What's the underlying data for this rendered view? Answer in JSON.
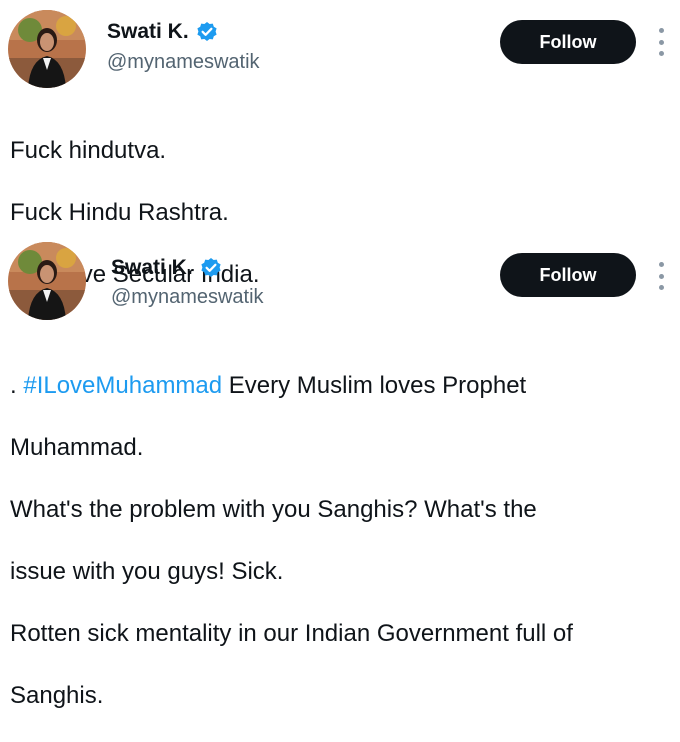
{
  "tweets": [
    {
      "author": {
        "display_name": "Swati K.",
        "handle": "@mynameswatik",
        "verified": true,
        "verified_icon": "verified-badge-icon"
      },
      "follow_label": "Follow",
      "more_icon": "more-options-icon",
      "text_lines": [
        "Fuck hindutva.",
        "Fuck Hindu Rashtra.",
        "Long live Secular India."
      ]
    },
    {
      "author": {
        "display_name": "Swati K.",
        "handle": "@mynameswatik",
        "verified": true,
        "verified_icon": "verified-badge-icon"
      },
      "follow_label": "Follow",
      "more_icon": "more-options-icon",
      "text_prefix": ". ",
      "hashtag": "#ILoveMuhammad",
      "text_after_hashtag": " Every Muslim loves Prophet",
      "text_lines": [
        "Muhammad.",
        "What's the problem with you Sanghis? What's the",
        "issue with you guys! Sick.",
        "Rotten sick mentality in our Indian Government full of",
        "Sanghis."
      ]
    }
  ],
  "colors": {
    "text": "#0f1419",
    "secondary": "#536471",
    "hashtag": "#1d9bf0",
    "verified": "#1d9bf0",
    "button_bg": "#0f1419",
    "button_text": "#ffffff"
  }
}
